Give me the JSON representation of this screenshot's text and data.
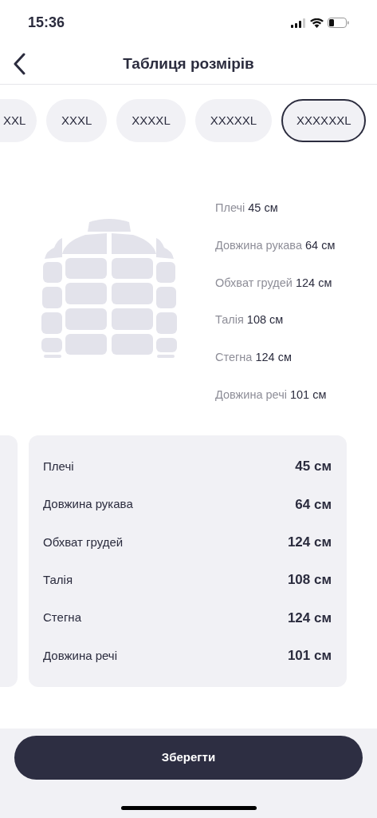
{
  "status_bar": {
    "time": "15:36"
  },
  "header": {
    "title": "Таблиця розмірів"
  },
  "sizes": [
    {
      "label": "XXL",
      "selected": false
    },
    {
      "label": "XXXL",
      "selected": false
    },
    {
      "label": "XXXXL",
      "selected": false
    },
    {
      "label": "XXXXXL",
      "selected": false
    },
    {
      "label": "XXXXXXL",
      "selected": true
    }
  ],
  "measurements_overview": [
    {
      "label": "Плечі",
      "value": "45 см"
    },
    {
      "label": "Довжина рукава",
      "value": "64 см"
    },
    {
      "label": "Обхват грудей",
      "value": "124 см"
    },
    {
      "label": "Талія",
      "value": "108 см"
    },
    {
      "label": "Стегна",
      "value": "124 см"
    },
    {
      "label": "Довжина речі",
      "value": "101 см"
    }
  ],
  "size_card": {
    "rows": [
      {
        "label": "Плечі",
        "value": "45 см"
      },
      {
        "label": "Довжина рукава",
        "value": "64 см"
      },
      {
        "label": "Обхват грудей",
        "value": "124 см"
      },
      {
        "label": "Талія",
        "value": "108 см"
      },
      {
        "label": "Стегна",
        "value": "124 см"
      },
      {
        "label": "Довжина речі",
        "value": "101 см"
      }
    ]
  },
  "save_button": "Зберегти"
}
